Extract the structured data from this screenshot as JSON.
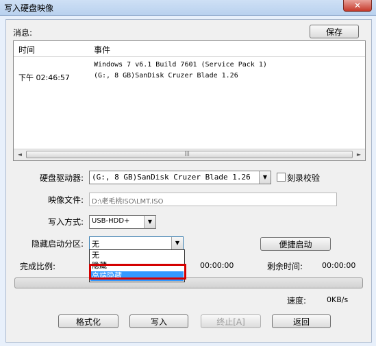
{
  "window": {
    "title": "写入硬盘映像",
    "close_glyph": "✕"
  },
  "messages": {
    "label": "消息:",
    "save_label": "保存",
    "columns": {
      "time": "时间",
      "event": "事件"
    },
    "rows": [
      {
        "time": "",
        "event": "Windows 7 v6.1 Build 7601 (Service Pack 1)"
      },
      {
        "time": "下午 02:46:57",
        "event": "(G:, 8 GB)SanDisk Cruzer Blade    1.26"
      }
    ],
    "scroll_grip": "|||"
  },
  "form": {
    "drive_label": "硬盘驱动器:",
    "drive_value": "(G:, 8 GB)SanDisk Cruzer Blade    1.26",
    "verify_label": "刻录校验",
    "image_label": "映像文件:",
    "image_value": "D:\\老毛桃ISO\\LMT.ISO",
    "write_mode_label": "写入方式:",
    "write_mode_value": "USB-HDD+",
    "hide_label": "隐藏启动分区:",
    "hide_value": "无",
    "hide_options": [
      "无",
      "隐藏",
      "高端隐藏"
    ],
    "hide_selected_index": 2,
    "quick_start_label": "便捷启动"
  },
  "progress": {
    "completion_label": "完成比例:",
    "elapsed": "00:00:00",
    "remaining_label": "剩余时间:",
    "remaining": "00:00:00",
    "percent": 0,
    "speed_label": "速度:",
    "speed_value": "0KB/s"
  },
  "buttons": {
    "format": "格式化",
    "write": "写入",
    "abort": "终止[A]",
    "back": "返回"
  },
  "icons": {
    "dropdown": "▼",
    "left": "◄",
    "right": "►"
  }
}
